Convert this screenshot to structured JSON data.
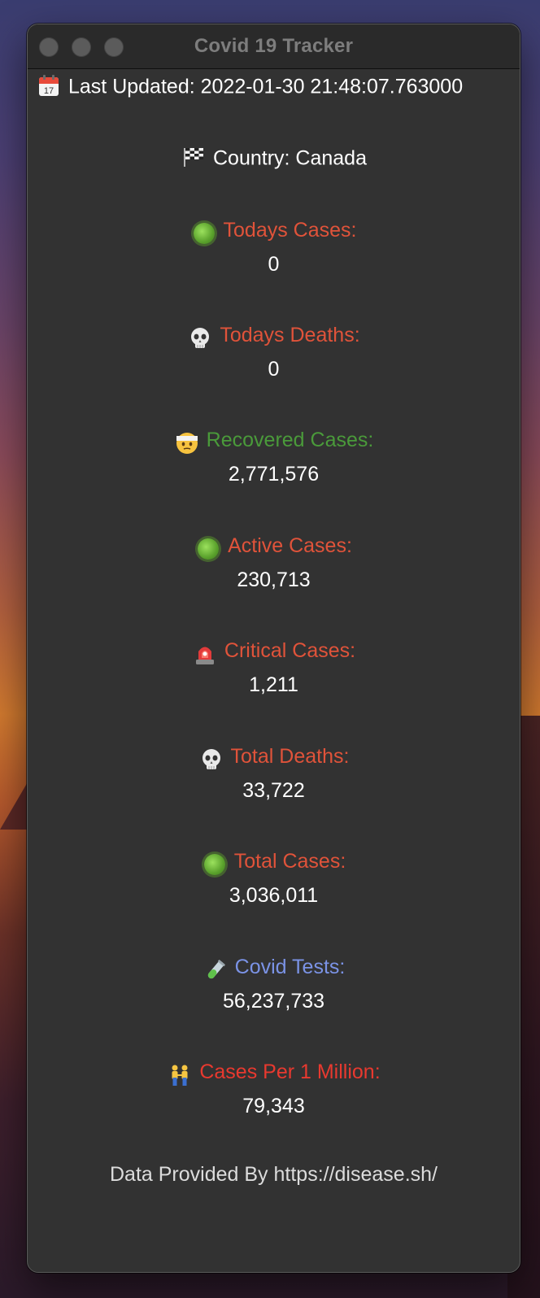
{
  "window": {
    "title": "Covid 19 Tracker"
  },
  "header": {
    "updated_icon": "calendar-icon",
    "updated_text": "Last Updated: 2022-01-30 21:48:07.763000",
    "country_icon": "checkered-flag-icon",
    "country_text": "Country: Canada"
  },
  "stats": [
    {
      "icon": "virus-icon",
      "label": "Todays Cases:",
      "value": "0",
      "color": "#e0533a"
    },
    {
      "icon": "skull-icon",
      "label": "Todays Deaths:",
      "value": "0",
      "color": "#e0533a"
    },
    {
      "icon": "bandaged-face-icon",
      "label": "Recovered Cases:",
      "value": "2,771,576",
      "color": "#4a9a3a"
    },
    {
      "icon": "virus-icon",
      "label": "Active Cases:",
      "value": "230,713",
      "color": "#e0533a"
    },
    {
      "icon": "siren-icon",
      "label": "Critical Cases:",
      "value": "1,211",
      "color": "#e0533a"
    },
    {
      "icon": "skull-icon",
      "label": "Total Deaths:",
      "value": "33,722",
      "color": "#e0533a"
    },
    {
      "icon": "virus-icon",
      "label": "Total Cases:",
      "value": "3,036,011",
      "color": "#e0533a"
    },
    {
      "icon": "test-tube-icon",
      "label": "Covid Tests:",
      "value": "56,237,733",
      "color": "#7b93e6"
    },
    {
      "icon": "people-holding-hands-icon",
      "label": "Cases Per 1 Million:",
      "value": "79,343",
      "color": "#e8392f"
    }
  ],
  "footer": {
    "text": "Data Provided By https://disease.sh/"
  }
}
